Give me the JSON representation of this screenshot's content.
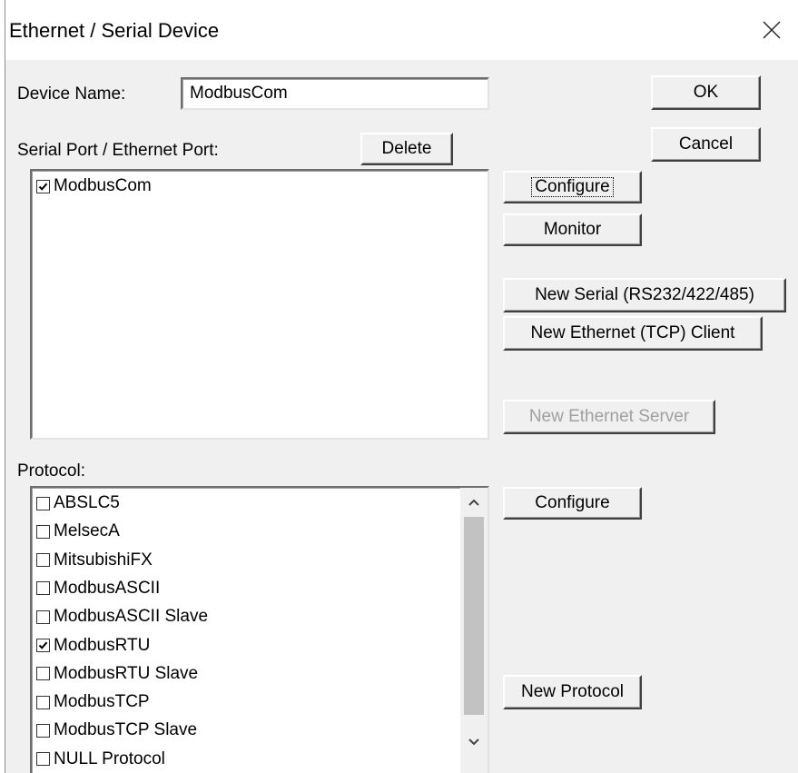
{
  "window": {
    "title": "Ethernet / Serial Device"
  },
  "device_name": {
    "label": "Device Name:",
    "value": "ModbusCom"
  },
  "ports": {
    "label": "Serial Port / Ethernet Port:",
    "delete_label": "Delete",
    "items": [
      {
        "label": "ModbusCom",
        "checked": true
      }
    ]
  },
  "buttons": {
    "ok": "OK",
    "cancel": "Cancel",
    "configure_port": "Configure",
    "monitor": "Monitor",
    "new_serial": "New Serial (RS232/422/485)",
    "new_ethernet_client": "New Ethernet (TCP) Client",
    "new_ethernet_server": "New Ethernet Server",
    "configure_protocol": "Configure",
    "new_protocol": "New Protocol"
  },
  "protocol": {
    "label": "Protocol:",
    "items": [
      {
        "label": "ABSLC5",
        "checked": false
      },
      {
        "label": "MelsecA",
        "checked": false
      },
      {
        "label": "MitsubishiFX",
        "checked": false
      },
      {
        "label": "ModbusASCII",
        "checked": false
      },
      {
        "label": "ModbusASCII Slave",
        "checked": false
      },
      {
        "label": "ModbusRTU",
        "checked": true
      },
      {
        "label": "ModbusRTU Slave",
        "checked": false
      },
      {
        "label": "ModbusTCP",
        "checked": false
      },
      {
        "label": "ModbusTCP Slave",
        "checked": false
      },
      {
        "label": "NULL Protocol",
        "checked": false
      }
    ]
  },
  "icons": {
    "close": "close-icon",
    "scroll_up": "chevron-up-icon",
    "scroll_down": "chevron-down-icon",
    "check": "checkmark-icon"
  }
}
